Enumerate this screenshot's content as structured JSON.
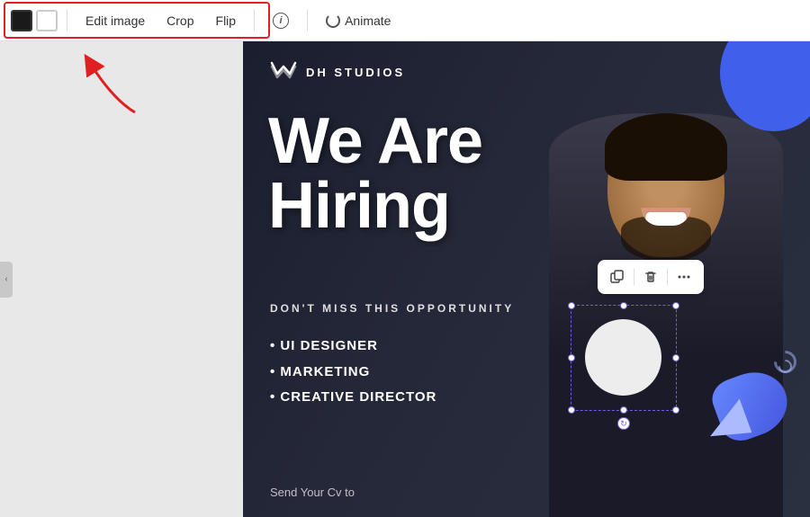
{
  "toolbar": {
    "swatch_black_label": "Black swatch",
    "swatch_white_label": "White swatch",
    "edit_image_label": "Edit image",
    "crop_label": "Crop",
    "flip_label": "Flip",
    "animate_label": "Animate"
  },
  "canvas": {
    "logo_text": "DH STUDIOS",
    "headline_line1": "We Are",
    "headline_line2": "Hiring",
    "subheadline": "DON'T MISS THIS OPPORTUNITY",
    "bullet1": "UI DESIGNER",
    "bullet2": "MARKETING",
    "bullet3": "CREATIVE DIRECTOR",
    "send_text": "Send Your Cv to"
  },
  "element_toolbar": {
    "copy_label": "Copy",
    "delete_label": "Delete",
    "more_label": "More options"
  },
  "colors": {
    "accent_blue": "#4466ff",
    "selection_purple": "#7766cc",
    "toolbar_border_red": "#e02020"
  }
}
